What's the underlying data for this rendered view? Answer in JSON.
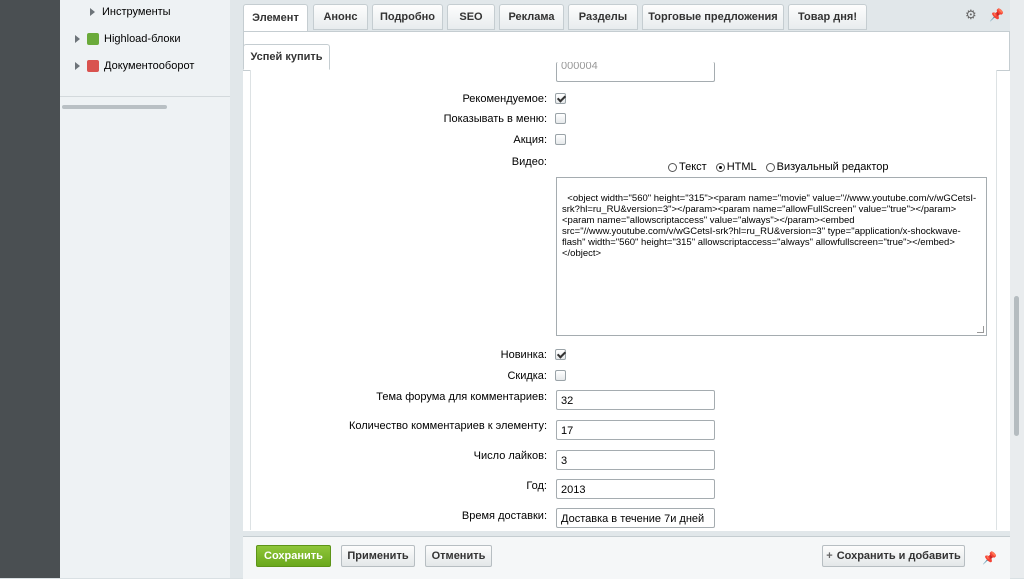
{
  "sidebar": {
    "items": [
      {
        "label": "Инструменты",
        "icon": "arrow-right-icon"
      },
      {
        "label": "Highload-блоки",
        "icon": "database-icon"
      },
      {
        "label": "Документооборот",
        "icon": "document-icon"
      }
    ]
  },
  "tabs": [
    {
      "label": "Элемент"
    },
    {
      "label": "Анонс"
    },
    {
      "label": "Подробно"
    },
    {
      "label": "SEO"
    },
    {
      "label": "Реклама"
    },
    {
      "label": "Разделы"
    },
    {
      "label": "Торговые предложения"
    },
    {
      "label": "Товар дня!"
    }
  ],
  "subtab": {
    "label": "Успей купить"
  },
  "top_partial_value": "000004",
  "fields": {
    "recommended": {
      "label": "Рекомендуемое:",
      "checked": true
    },
    "show_in_menu": {
      "label": "Показывать в меню:",
      "checked": false
    },
    "promo": {
      "label": "Акция:",
      "checked": false
    },
    "video": {
      "label": "Видео:"
    },
    "new": {
      "label": "Новинка:",
      "checked": true
    },
    "discount": {
      "label": "Скидка:",
      "checked": false
    },
    "forum_topic": {
      "label": "Тема форума для комментариев:",
      "value": "32"
    },
    "comments_count": {
      "label": "Количество комментариев к элементу:",
      "value": "17"
    },
    "likes": {
      "label": "Число лайков:",
      "value": "3"
    },
    "year": {
      "label": "Год:",
      "value": "2013"
    },
    "delivery": {
      "label": "Время доставки:",
      "value": "Доставка в течение 7и дней"
    }
  },
  "editor_modes": {
    "text": "Текст",
    "html": "HTML",
    "visual": "Визуальный редактор",
    "selected": "html"
  },
  "video_code": "<object width=\"560\" height=\"315\"><param name=\"movie\" value=\"//www.youtube.com/v/wGCetsI-srk?hl=ru_RU&version=3\"></param><param name=\"allowFullScreen\" value=\"true\"></param><param name=\"allowscriptaccess\" value=\"always\"></param><embed src=\"//www.youtube.com/v/wGCetsI-srk?hl=ru_RU&version=3\" type=\"application/x-shockwave-flash\" width=\"560\" height=\"315\" allowscriptaccess=\"always\" allowfullscreen=\"true\"></embed></object>",
  "buttons": {
    "save": "Сохранить",
    "apply": "Применить",
    "cancel": "Отменить",
    "save_add": "Сохранить и добавить"
  },
  "colors": {
    "save_green": "#7ab52a",
    "sidebar_dark": "#4a4f52"
  }
}
